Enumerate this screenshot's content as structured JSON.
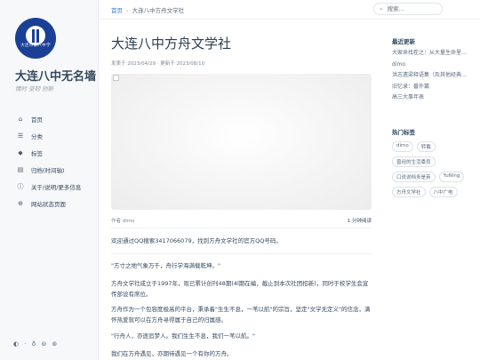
{
  "site": {
    "title": "大连八中无名墙",
    "subtitle": "情时 坚韧 创新",
    "logo_text": "大连市第八中学",
    "accent": "#1a3f95"
  },
  "nav": [
    {
      "icon": "home-icon",
      "glyph": "⌂",
      "label": "首页"
    },
    {
      "icon": "list-icon",
      "glyph": "☰",
      "label": "分类"
    },
    {
      "icon": "tag-icon",
      "glyph": "◆",
      "label": "标签"
    },
    {
      "icon": "archive-icon",
      "glyph": "▤",
      "label": "归档(时间轴)"
    },
    {
      "icon": "info-icon",
      "glyph": "ⓘ",
      "label": "关于/说明/更多信息"
    },
    {
      "icon": "globe-icon",
      "glyph": "⊕",
      "label": "网站状态页面"
    }
  ],
  "footer_icons": [
    "◐",
    "·",
    "♁",
    "⊜",
    "⊛"
  ],
  "breadcrumb": {
    "home": "首页",
    "current": "大连八中方舟文学社"
  },
  "search": {
    "placeholder": "搜索..."
  },
  "post": {
    "title": "大连八中方舟文学社",
    "meta": "发表于 2023/04/29 · 更新于 2023/08/10",
    "author": "作者 dimo",
    "read_time": "1 分钟阅读",
    "paragraphs": [
      "欢迎通过QQ搜索3417066079，找到方舟文学社的官方QQ号码。",
      "\"方寸之地气象万千，舟行学海满载乾坤。\"",
      "方舟文学社成立于1997年，现已累计创刊48期(4l期在编，截止到本次社团招新)，同时于校学生会宣传部设有席位。",
      "方舟作为一个包容度极高的平台，秉承着\"生生不息，一苇以航\"的宗旨，坚定\"文学无定义\"的信念，满怀热爱就可以在方舟寻得属于自己的归属感。",
      "\"行舟人，亦逐追梦人。我们生生不息，我们一苇以航。\"",
      "我们在方舟遇见，亦期待遇见一个有你的方舟。"
    ]
  },
  "recent": {
    "heading": "最近更新",
    "items": [
      "大家来找茬之：从大量生命里…",
      "dimo",
      "洪志遗梁释语集（及其他经典…",
      "旧忆录：番外篇",
      "高三大事年表"
    ]
  },
  "tags": {
    "heading": "热门标签",
    "items": [
      "dimo",
      "转载",
      "曾经的生活委员",
      "口说说档多是英",
      "YuNing",
      "方舟文学社",
      "八中广电"
    ]
  }
}
